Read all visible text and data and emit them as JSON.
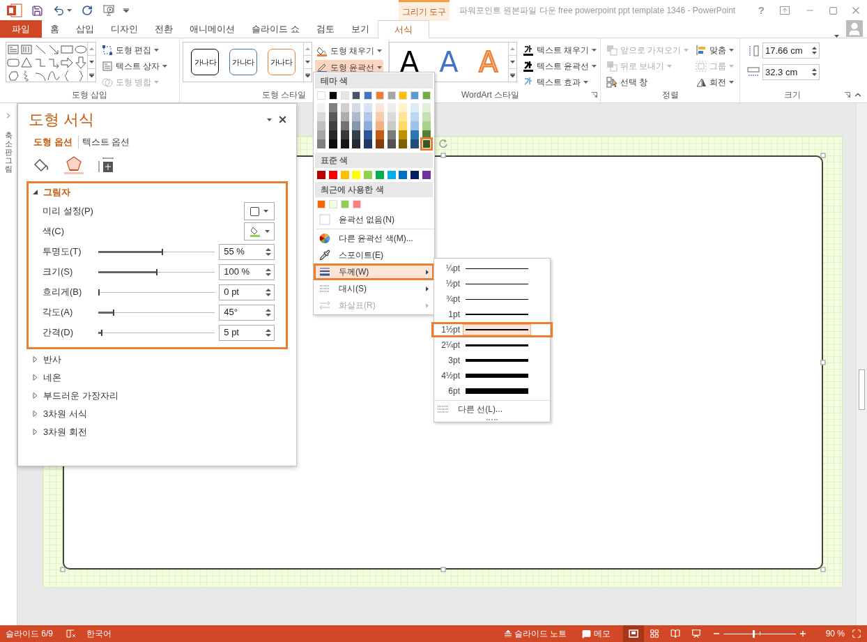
{
  "title_bar": {
    "contextual_tab": "그리기 도구",
    "title": "파워포인트 원본파일 다운 free powerpoint ppt template 1346 - PowerPoint",
    "help": "?"
  },
  "tabs": [
    {
      "label": "파일",
      "kind": "file",
      "selected": false
    },
    {
      "label": "홈",
      "kind": "tab",
      "selected": false
    },
    {
      "label": "삽입",
      "kind": "tab",
      "selected": false
    },
    {
      "label": "디자인",
      "kind": "tab",
      "selected": false
    },
    {
      "label": "전환",
      "kind": "tab",
      "selected": false
    },
    {
      "label": "애니메이션",
      "kind": "tab",
      "selected": false
    },
    {
      "label": "슬라이드 쇼",
      "kind": "tab",
      "selected": false
    },
    {
      "label": "검토",
      "kind": "tab",
      "selected": false
    },
    {
      "label": "보기",
      "kind": "tab",
      "selected": false
    },
    {
      "label": "서식",
      "kind": "contextual",
      "selected": true
    }
  ],
  "ribbon": {
    "insert_shapes": {
      "group_label": "도형 삽입",
      "commands": [
        {
          "label": "도형 편집",
          "kind": "edit",
          "disabled": false
        },
        {
          "label": "텍스트 상자",
          "kind": "textbox",
          "disabled": false
        },
        {
          "label": "도형 병합",
          "kind": "merge",
          "disabled": true
        }
      ]
    },
    "shape_styles": {
      "group_label": "도형 스타일",
      "presets": [
        {
          "label": "가나다",
          "color": "#000000"
        },
        {
          "label": "가나다",
          "color": "#41719c"
        },
        {
          "label": "가나다",
          "color": "#ed7d31"
        }
      ],
      "commands": [
        {
          "label": "도형 채우기",
          "kind": "fill",
          "pressed": false
        },
        {
          "label": "도형 윤곽선",
          "kind": "outline",
          "pressed": true
        }
      ]
    },
    "wordart": {
      "group_label": "WordArt 스타일",
      "presets": [
        {
          "label": "A",
          "kind": "solid",
          "color": "#000000"
        },
        {
          "label": "A",
          "kind": "solid",
          "color": "#4472c4"
        },
        {
          "label": "A",
          "kind": "outline",
          "color": "#f4b183"
        }
      ],
      "commands": [
        {
          "label": "텍스트 채우기",
          "kind": "fill"
        },
        {
          "label": "텍스트 윤곽선",
          "kind": "outline"
        },
        {
          "label": "텍스트 효과",
          "kind": "effects"
        }
      ]
    },
    "arrange": {
      "group_label": "정렬",
      "commands": [
        {
          "label": "앞으로 가져오기",
          "kind": "bring",
          "disabled": true
        },
        {
          "label": "뒤로 보내기",
          "kind": "send",
          "disabled": true
        },
        {
          "label": "선택 창",
          "kind": "pane",
          "disabled": false
        },
        {
          "label": "맞춤",
          "kind": "align",
          "disabled": false
        },
        {
          "label": "그룹",
          "kind": "group",
          "disabled": true
        },
        {
          "label": "회전",
          "kind": "rotate",
          "disabled": false
        }
      ]
    },
    "size": {
      "group_label": "크기",
      "height": "17.66 cm",
      "width": "32.3 cm"
    }
  },
  "thumbnail_strip": {
    "label": "축소판 그림"
  },
  "format_pane": {
    "title": "도형 서식",
    "option_tabs": [
      {
        "label": "도형 옵션",
        "selected": true
      },
      {
        "label": "텍스트 옵션",
        "selected": false
      }
    ],
    "icon_tabs": [
      {
        "kind": "fill",
        "selected": false
      },
      {
        "kind": "effects",
        "selected": true
      },
      {
        "kind": "layout",
        "selected": false
      }
    ],
    "sections": [
      {
        "label": "그림자",
        "expanded": true,
        "rows": [
          {
            "label": "미리 설정(P)",
            "kind": "preset"
          },
          {
            "label": "색(C)",
            "kind": "color",
            "color": "#92d050"
          },
          {
            "label": "투명도(T)",
            "kind": "slider",
            "level": 0.55,
            "value": "55 %"
          },
          {
            "label": "크기(S)",
            "kind": "slider",
            "level": 0.5,
            "value": "100 %"
          },
          {
            "label": "흐리게(B)",
            "kind": "slider",
            "level": 0,
            "value": "0 pt"
          },
          {
            "label": "각도(A)",
            "kind": "slider",
            "level": 0.125,
            "value": "45°"
          },
          {
            "label": "간격(D)",
            "kind": "slider",
            "level": 0.025,
            "value": "5 pt"
          }
        ]
      },
      {
        "label": "반사",
        "expanded": false
      },
      {
        "label": "네온",
        "expanded": false
      },
      {
        "label": "부드러운 가장자리",
        "expanded": false
      },
      {
        "label": "3차원 서식",
        "expanded": false
      },
      {
        "label": "3차원 회전",
        "expanded": false
      }
    ]
  },
  "outline_menu": {
    "theme_label": "테마 색",
    "theme_colors": [
      {
        "color": "#ffffff",
        "selected": false,
        "shades": [
          {
            "color": "#f2f2f2",
            "selected": false
          },
          {
            "color": "#d9d9d9",
            "selected": false
          },
          {
            "color": "#bfbfbf",
            "selected": false
          },
          {
            "color": "#a6a6a6",
            "selected": false
          },
          {
            "color": "#808080",
            "selected": false
          }
        ]
      },
      {
        "color": "#000000",
        "selected": false,
        "shades": [
          {
            "color": "#808080",
            "selected": false
          },
          {
            "color": "#595959",
            "selected": false
          },
          {
            "color": "#404040",
            "selected": false
          },
          {
            "color": "#262626",
            "selected": false
          },
          {
            "color": "#0d0d0d",
            "selected": false
          }
        ]
      },
      {
        "color": "#e7e6e6",
        "selected": false,
        "shades": [
          {
            "color": "#d0cece",
            "selected": false
          },
          {
            "color": "#aeabab",
            "selected": false
          },
          {
            "color": "#757171",
            "selected": false
          },
          {
            "color": "#3b3838",
            "selected": false
          },
          {
            "color": "#161616",
            "selected": false
          }
        ]
      },
      {
        "color": "#44546a",
        "selected": false,
        "shades": [
          {
            "color": "#d6dce5",
            "selected": false
          },
          {
            "color": "#adb9ca",
            "selected": false
          },
          {
            "color": "#8497b0",
            "selected": false
          },
          {
            "color": "#333f50",
            "selected": false
          },
          {
            "color": "#222a35",
            "selected": false
          }
        ]
      },
      {
        "color": "#4472c4",
        "selected": false,
        "shades": [
          {
            "color": "#dae3f3",
            "selected": false
          },
          {
            "color": "#b4c7e7",
            "selected": false
          },
          {
            "color": "#8faadc",
            "selected": false
          },
          {
            "color": "#2f5597",
            "selected": false
          },
          {
            "color": "#203864",
            "selected": false
          }
        ]
      },
      {
        "color": "#ed7d31",
        "selected": false,
        "shades": [
          {
            "color": "#fbe5d6",
            "selected": false
          },
          {
            "color": "#f8cbad",
            "selected": false
          },
          {
            "color": "#f4b183",
            "selected": false
          },
          {
            "color": "#c55a11",
            "selected": false
          },
          {
            "color": "#843c0c",
            "selected": false
          }
        ]
      },
      {
        "color": "#a5a5a5",
        "selected": false,
        "shades": [
          {
            "color": "#ededed",
            "selected": false
          },
          {
            "color": "#dbdbdb",
            "selected": false
          },
          {
            "color": "#c9c9c9",
            "selected": false
          },
          {
            "color": "#7b7b7b",
            "selected": false
          },
          {
            "color": "#525252",
            "selected": false
          }
        ]
      },
      {
        "color": "#ffc000",
        "selected": false,
        "shades": [
          {
            "color": "#fff2cc",
            "selected": false
          },
          {
            "color": "#ffe699",
            "selected": false
          },
          {
            "color": "#ffd966",
            "selected": false
          },
          {
            "color": "#bf9000",
            "selected": false
          },
          {
            "color": "#7f6000",
            "selected": false
          }
        ]
      },
      {
        "color": "#5b9bd5",
        "selected": false,
        "shades": [
          {
            "color": "#deebf7",
            "selected": false
          },
          {
            "color": "#bdd7ee",
            "selected": false
          },
          {
            "color": "#9dc3e6",
            "selected": false
          },
          {
            "color": "#2e75b6",
            "selected": false
          },
          {
            "color": "#1f4e79",
            "selected": false
          }
        ]
      },
      {
        "color": "#70ad47",
        "selected": false,
        "shades": [
          {
            "color": "#e2f0d9",
            "selected": false
          },
          {
            "color": "#c5e0b4",
            "selected": false
          },
          {
            "color": "#a9d18e",
            "selected": false
          },
          {
            "color": "#548235",
            "selected": false
          },
          {
            "color": "#385723",
            "selected": true
          }
        ]
      }
    ],
    "standard_label": "표준 색",
    "standard_colors": [
      {
        "color": "#c00000",
        "selected": false
      },
      {
        "color": "#ff0000",
        "selected": false
      },
      {
        "color": "#ffc000",
        "selected": false
      },
      {
        "color": "#ffff00",
        "selected": false
      },
      {
        "color": "#92d050",
        "selected": false
      },
      {
        "color": "#00b050",
        "selected": false
      },
      {
        "color": "#00b0f0",
        "selected": false
      },
      {
        "color": "#0070c0",
        "selected": false
      },
      {
        "color": "#002060",
        "selected": false
      },
      {
        "color": "#7030a0",
        "selected": false
      }
    ],
    "recent_label": "최근에 사용한 색",
    "recent_colors": [
      {
        "color": "#ff6600",
        "selected": false
      },
      {
        "color": "#f0ffdd",
        "selected": false
      },
      {
        "color": "#92d050",
        "selected": false
      },
      {
        "color": "#ff7c80",
        "selected": false
      }
    ],
    "items": [
      {
        "label": "윤곽선 없음(N)",
        "kind": "none",
        "selected": false,
        "disabled": false,
        "submenu": false
      },
      {
        "label": "다른 윤곽선 색(M)...",
        "kind": "more-colors",
        "selected": false,
        "disabled": false,
        "submenu": false
      },
      {
        "label": "스포이트(E)",
        "kind": "eyedropper",
        "selected": false,
        "disabled": false,
        "submenu": false
      },
      {
        "label": "두께(W)",
        "kind": "weight",
        "selected": true,
        "disabled": false,
        "submenu": true
      },
      {
        "label": "대시(S)",
        "kind": "dash",
        "selected": false,
        "disabled": false,
        "submenu": true
      },
      {
        "label": "화살표(R)",
        "kind": "arrows",
        "selected": false,
        "disabled": true,
        "submenu": true
      }
    ]
  },
  "weight_menu": {
    "items": [
      {
        "label": "¼pt",
        "selected": false
      },
      {
        "label": "½pt",
        "selected": false
      },
      {
        "label": "¾pt",
        "selected": false
      },
      {
        "label": "1pt",
        "selected": false
      },
      {
        "label": "1½pt",
        "selected": true
      },
      {
        "label": "2¼pt",
        "selected": false
      },
      {
        "label": "3pt",
        "selected": false
      },
      {
        "label": "4½pt",
        "selected": false
      },
      {
        "label": "6pt",
        "selected": false
      }
    ],
    "more": "다른 선(L)..."
  },
  "status_bar": {
    "slide": "슬라이드 6/9",
    "language": "한국어",
    "notes": "슬라이드 노트",
    "comments": "메모",
    "views": [
      {
        "kind": "normal",
        "selected": true
      },
      {
        "kind": "sorter",
        "selected": false
      },
      {
        "kind": "reading",
        "selected": false
      },
      {
        "kind": "slideshow",
        "selected": false
      }
    ],
    "zoom_slider": {
      "level": 0.42
    },
    "zoom": "90 %"
  }
}
